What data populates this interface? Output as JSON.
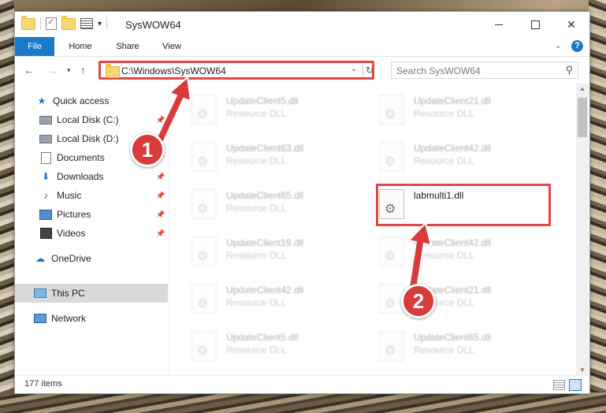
{
  "window": {
    "title": "SysWOW64",
    "minimize_glyph": "",
    "close_glyph": "✕"
  },
  "ribbon": {
    "tabs": [
      {
        "label": "File"
      },
      {
        "label": "Home"
      },
      {
        "label": "Share"
      },
      {
        "label": "View"
      }
    ],
    "help_glyph": "?"
  },
  "address": {
    "path": "C:\\Windows\\SysWOW64",
    "search_placeholder": "Search SysWOW64"
  },
  "nav": {
    "items": [
      {
        "label": "Quick access",
        "icon": "star-icon"
      },
      {
        "label": "Local Disk (C:)",
        "icon": "disk-icon",
        "pinned": true
      },
      {
        "label": "Local Disk (D:)",
        "icon": "disk-icon",
        "pinned": true
      },
      {
        "label": "Documents",
        "icon": "documents-icon",
        "pinned": true
      },
      {
        "label": "Downloads",
        "icon": "downloads-icon",
        "pinned": true
      },
      {
        "label": "Music",
        "icon": "music-icon",
        "pinned": true
      },
      {
        "label": "Pictures",
        "icon": "pictures-icon",
        "pinned": true
      },
      {
        "label": "Videos",
        "icon": "videos-icon",
        "pinned": true
      },
      {
        "label": "OneDrive",
        "icon": "onedrive-icon"
      },
      {
        "label": "This PC",
        "icon": "this-pc-icon",
        "selected": true
      },
      {
        "label": "Network",
        "icon": "network-icon"
      }
    ]
  },
  "files": [
    {
      "name": "UpdateClient5.dll",
      "type": "Resource DLL"
    },
    {
      "name": "UpdateClient21.dll",
      "type": "Resource DLL"
    },
    {
      "name": "UpdateClient63.dll",
      "type": "Resource DLL"
    },
    {
      "name": "UpdateClient42.dll",
      "type": "Resource DLL"
    },
    {
      "name": "UpdateClient65.dll",
      "type": "Resource DLL"
    },
    {
      "name": "labmulti1.dll",
      "type": "",
      "highlighted": true
    },
    {
      "name": "UpdateClient19.dll",
      "type": "Resource DLL"
    },
    {
      "name": "UpdateClient42.dll",
      "type": "Resource DLL"
    },
    {
      "name": "UpdateClient42.dll",
      "type": "Resource DLL"
    },
    {
      "name": "UpdateClient21.dll",
      "type": "Resource DLL"
    },
    {
      "name": "UpdateClient5.dll",
      "type": "Resource DLL"
    },
    {
      "name": "UpdateClient65.dll",
      "type": "Resource DLL"
    }
  ],
  "status": {
    "item_count": "177 items"
  },
  "callouts": [
    {
      "label": "1"
    },
    {
      "label": "2"
    }
  ],
  "colors": {
    "accent": "#1979ca",
    "callout": "#d93a3a",
    "highlight_border": "#e04848"
  }
}
